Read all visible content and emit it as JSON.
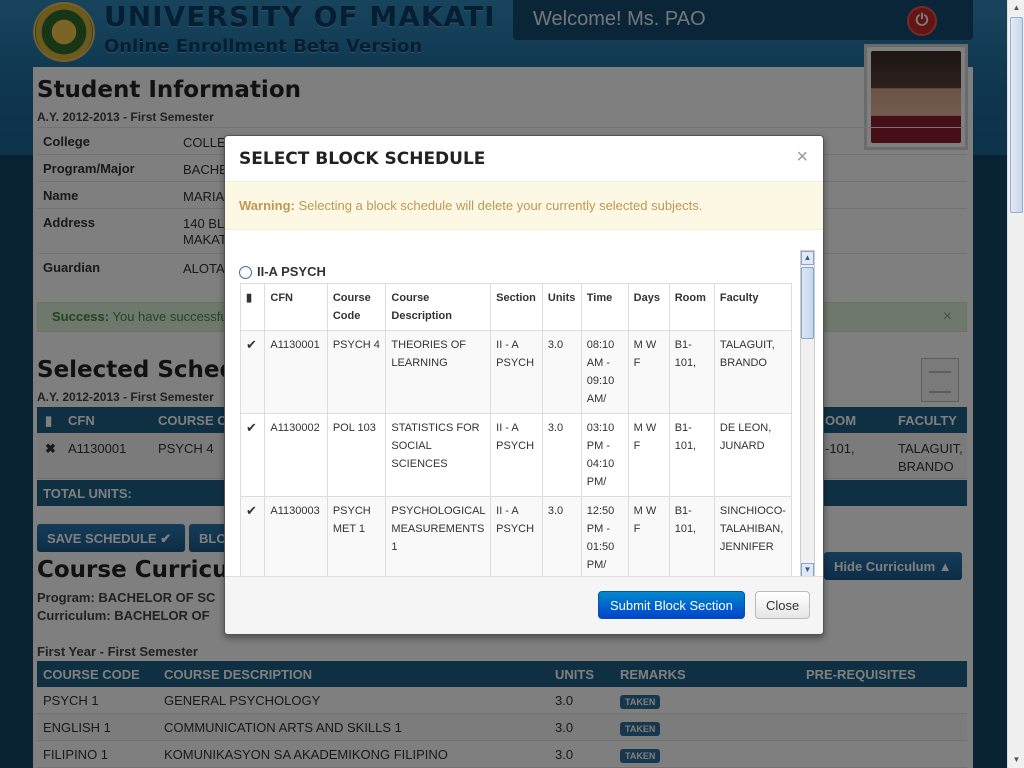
{
  "header": {
    "title": "UNIVERSITY OF MAKATI",
    "subtitle": "Online Enrollment Beta Version",
    "welcome": "Welcome! Ms. PAO"
  },
  "student_info": {
    "heading": "Student Information",
    "term": "A.Y. 2012-2013 - First Semester",
    "rows": [
      {
        "label": "College",
        "value": "COLLE"
      },
      {
        "label": "Program/Major",
        "value": "BACHE"
      },
      {
        "label": "Name",
        "value": "MARIA"
      },
      {
        "label": "Address",
        "value": "140 BL",
        "value2": "MAKAT"
      },
      {
        "label": "Guardian",
        "value": "ALOTA"
      }
    ]
  },
  "success_alert": {
    "strong": "Success:",
    "text": "You have successfu"
  },
  "selected_schedule": {
    "heading": "Selected Schedu",
    "term": "A.Y. 2012-2013 - First Semester",
    "columns": {
      "cfn": "CFN",
      "course_code": "COURSE C",
      "room": "OOM",
      "faculty": "FACULTY"
    },
    "row": {
      "cfn": "A1130001",
      "course_code": "PSYCH 4",
      "room": "-101,",
      "faculty_1": "TALAGUIT,",
      "faculty_2": "BRANDO"
    },
    "total_label": "TOTAL UNITS:"
  },
  "buttons": {
    "save_schedule": "SAVE SCHEDULE",
    "block_partial": "BLO",
    "hide_curriculum": "Hide Curriculum"
  },
  "curriculum": {
    "heading": "Course Curriculu",
    "program": "Program: BACHELOR OF SC",
    "curriculum": "Curriculum: BACHELOR OF",
    "year_sem": "First Year - First Semester",
    "columns": {
      "code": "COURSE CODE",
      "desc": "COURSE DESCRIPTION",
      "units": "UNITS",
      "remarks": "REMARKS",
      "prereq": "PRE-REQUISITES"
    },
    "rows": [
      {
        "code": "PSYCH 1",
        "desc": "GENERAL PSYCHOLOGY",
        "units": "3.0",
        "remarks": "TAKEN"
      },
      {
        "code": "ENGLISH 1",
        "desc": "COMMUNICATION ARTS AND SKILLS 1",
        "units": "3.0",
        "remarks": "TAKEN"
      },
      {
        "code": "FILIPINO 1",
        "desc": "KOMUNIKASYON SA AKADEMIKONG FILIPINO",
        "units": "3.0",
        "remarks": "TAKEN"
      }
    ]
  },
  "modal": {
    "title": "SELECT BLOCK SCHEDULE",
    "close_x": "×",
    "warning_strong": "Warning:",
    "warning_text": "Selecting a block schedule will delete your currently selected subjects.",
    "block_name": "II-A PSYCH",
    "columns": {
      "cfn": "CFN",
      "code_1": "Course",
      "code_2": "Code",
      "desc_1": "Course",
      "desc_2": "Description",
      "section": "Section",
      "units": "Units",
      "time": "Time",
      "days": "Days",
      "room": "Room",
      "faculty": "Faculty"
    },
    "rows": [
      {
        "cfn": "A1130001",
        "code": "PSYCH 4",
        "desc": "THEORIES OF LEARNING",
        "section": "II - A PSYCH",
        "units": "3.0",
        "time": "08:10 AM - 09:10 AM/",
        "days": "M W F",
        "room": "B1-101,",
        "faculty": "TALAGUIT, BRANDO"
      },
      {
        "cfn": "A1130002",
        "code": "POL 103",
        "desc": "STATISTICS FOR SOCIAL SCIENCES",
        "section": "II - A PSYCH",
        "units": "3.0",
        "time": "03:10 PM - 04:10 PM/",
        "days": "M W F",
        "room": "B1-101,",
        "faculty": "DE LEON, JUNARD"
      },
      {
        "cfn": "A1130003",
        "code": "PSYCH MET 1",
        "desc": "PSYCHOLOGICAL MEASUREMENTS 1",
        "section": "II - A PSYCH",
        "units": "3.0",
        "time": "12:50 PM - 01:50 PM/",
        "days": "M W F",
        "room": "B1-101,",
        "faculty": "SINCHIOCO-TALAHIBAN, JENNIFER"
      }
    ],
    "submit_label": "Submit Block Section",
    "close_label": "Close"
  },
  "icons": {
    "check": "check-icon",
    "document": "document-icon",
    "remove": "x-icon",
    "power": "power-icon"
  }
}
